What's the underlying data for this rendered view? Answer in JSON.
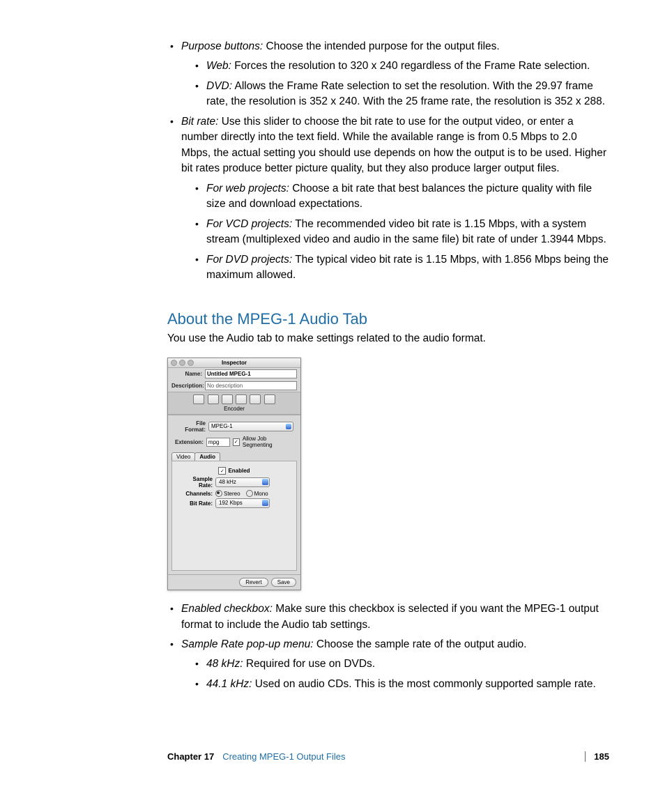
{
  "bullets_top": {
    "purpose_term": "Purpose buttons:",
    "purpose_text": "  Choose the intended purpose for the output files.",
    "web_term": "Web:",
    "web_text": "  Forces the resolution to 320 x 240 regardless of the Frame Rate selection.",
    "dvd_term": "DVD:",
    "dvd_text": "  Allows the Frame Rate selection to set the resolution. With the 29.97 frame rate, the resolution is 352 x 240. With the 25 frame rate, the resolution is 352 x 288.",
    "bitrate_term": "Bit rate:",
    "bitrate_text": "  Use this slider to choose the bit rate to use for the output video, or enter a number directly into the text field. While the available range is from 0.5 Mbps to 2.0 Mbps, the actual setting you should use depends on how the output is to be used. Higher bit rates produce better picture quality, but they also produce larger output files.",
    "webproj_term": "For web projects:",
    "webproj_text": "  Choose a bit rate that best balances the picture quality with file size and download expectations.",
    "vcd_term": "For VCD projects:",
    "vcd_text": "  The recommended video bit rate is 1.15 Mbps, with a system stream (multiplexed video and audio in the same file) bit rate of under 1.3944 Mbps.",
    "dvdproj_term": "For DVD projects:",
    "dvdproj_text": "  The typical video bit rate is 1.15 Mbps, with 1.856 Mbps being the maximum allowed."
  },
  "heading": "About the MPEG-1 Audio Tab",
  "intro": "You use the Audio tab to make settings related to the audio format.",
  "inspector": {
    "title": "Inspector",
    "name_label": "Name:",
    "name_value": "Untitled MPEG-1",
    "desc_label": "Description:",
    "desc_value": "No description",
    "encoder_label": "Encoder",
    "fileformat_label": "File Format:",
    "fileformat_value": "MPEG-1",
    "extension_label": "Extension:",
    "extension_value": "mpg",
    "allow_seg": "Allow Job Segmenting",
    "tab_video": "Video",
    "tab_audio": "Audio",
    "enabled_label": "Enabled",
    "samplerate_label": "Sample Rate:",
    "samplerate_value": "48 kHz",
    "channels_label": "Channels:",
    "stereo": "Stereo",
    "mono": "Mono",
    "bitrate_label": "Bit Rate:",
    "bitrate_value": "192 Kbps",
    "revert": "Revert",
    "save": "Save"
  },
  "bullets_bottom": {
    "enabled_term": "Enabled checkbox:",
    "enabled_text": "  Make sure this checkbox is selected if you want the MPEG-1 output format to include the Audio tab settings.",
    "sr_term": "Sample Rate pop-up menu:",
    "sr_text": "  Choose the sample rate of the output audio.",
    "k48_term": "48 kHz:",
    "k48_text": "  Required for use on DVDs.",
    "k44_term": "44.1 kHz:",
    "k44_text": "  Used on audio CDs. This is the most commonly supported sample rate."
  },
  "footer": {
    "chapter": "Chapter 17",
    "title": "Creating MPEG-1 Output Files",
    "page": "185"
  }
}
